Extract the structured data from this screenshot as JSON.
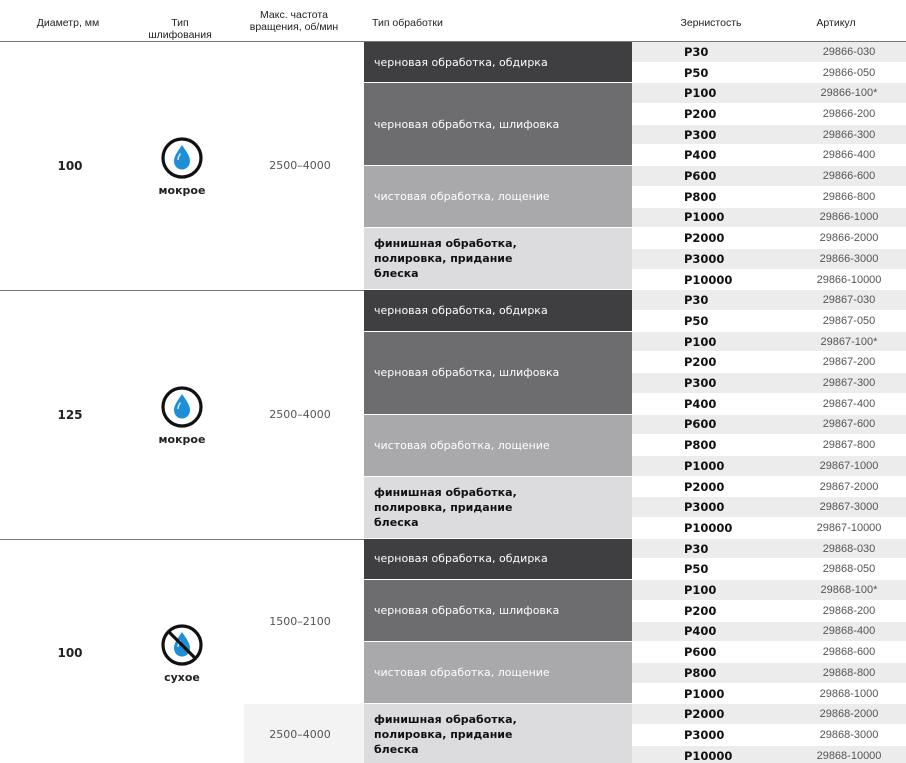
{
  "header": {
    "diameter": "Диаметр, мм",
    "grinding_type": "Тип шлифования",
    "rpm": "Макс. частота вращения, об/мин",
    "processing": "Тип обработки",
    "grit": "Зернистость",
    "article": "Артикул"
  },
  "groups": [
    {
      "diameter": "100",
      "type": "мокрое",
      "icon": "water-drop-icon",
      "rpm": "2500–4000",
      "processing": [
        {
          "label": "черновая обработка, обдирка",
          "rows": 2
        },
        {
          "label": "черновая обработка, шлифовка",
          "rows": 4
        },
        {
          "label": "чистовая обработка, лощение",
          "rows": 3
        },
        {
          "label": "финишная обработка, полировка, придание блеска",
          "rows": 3
        }
      ],
      "rows": [
        {
          "grit": "P30",
          "article": "29866-030"
        },
        {
          "grit": "P50",
          "article": "29866-050"
        },
        {
          "grit": "P100",
          "article": "29866-100*"
        },
        {
          "grit": "P200",
          "article": "29866-200"
        },
        {
          "grit": "P300",
          "article": "29866-300"
        },
        {
          "grit": "P400",
          "article": "29866-400"
        },
        {
          "grit": "P600",
          "article": "29866-600"
        },
        {
          "grit": "P800",
          "article": "29866-800"
        },
        {
          "grit": "P1000",
          "article": "29866-1000"
        },
        {
          "grit": "P2000",
          "article": "29866-2000"
        },
        {
          "grit": "P3000",
          "article": "29866-3000"
        },
        {
          "grit": "P10000",
          "article": "29866-10000"
        }
      ]
    },
    {
      "diameter": "125",
      "type": "мокрое",
      "icon": "water-drop-icon",
      "rpm": "2500–4000",
      "processing": [
        {
          "label": "черновая обработка, обдирка",
          "rows": 2
        },
        {
          "label": "черновая обработка, шлифовка",
          "rows": 4
        },
        {
          "label": "чистовая обработка, лощение",
          "rows": 3
        },
        {
          "label": "финишная обработка, полировка, придание блеска",
          "rows": 3
        }
      ],
      "rows": [
        {
          "grit": "P30",
          "article": "29867-030"
        },
        {
          "grit": "P50",
          "article": "29867-050"
        },
        {
          "grit": "P100",
          "article": "29867-100*"
        },
        {
          "grit": "P200",
          "article": "29867-200"
        },
        {
          "grit": "P300",
          "article": "29867-300"
        },
        {
          "grit": "P400",
          "article": "29867-400"
        },
        {
          "grit": "P600",
          "article": "29867-600"
        },
        {
          "grit": "P800",
          "article": "29867-800"
        },
        {
          "grit": "P1000",
          "article": "29867-1000"
        },
        {
          "grit": "P2000",
          "article": "29867-2000"
        },
        {
          "grit": "P3000",
          "article": "29867-3000"
        },
        {
          "grit": "P10000",
          "article": "29867-10000"
        }
      ]
    },
    {
      "diameter": "100",
      "type": "сухое",
      "icon": "no-water-drop-icon",
      "rpm_primary": "1500–2100",
      "rpm_secondary": "2500–4000",
      "processing": [
        {
          "label": "черновая обработка, обдирка",
          "rows": 2
        },
        {
          "label": "черновая обработка, шлифовка",
          "rows": 3
        },
        {
          "label": "чистовая обработка, лощение",
          "rows": 3
        },
        {
          "label": "финишная обработка, полировка, придание блеска",
          "rows": 3
        }
      ],
      "rows": [
        {
          "grit": "P30",
          "article": "29868-030"
        },
        {
          "grit": "P50",
          "article": "29868-050"
        },
        {
          "grit": "P100",
          "article": "29868-100*"
        },
        {
          "grit": "P200",
          "article": "29868-200"
        },
        {
          "grit": "P400",
          "article": "29868-400"
        },
        {
          "grit": "P600",
          "article": "29868-600"
        },
        {
          "grit": "P800",
          "article": "29868-800"
        },
        {
          "grit": "P1000",
          "article": "29868-1000"
        },
        {
          "grit": "P2000",
          "article": "29868-2000"
        },
        {
          "grit": "P3000",
          "article": "29868-3000"
        },
        {
          "grit": "P10000",
          "article": "29868-10000"
        }
      ]
    }
  ],
  "colors": {
    "proc_dark": "#3f3f42",
    "proc_mid": "#6d6d70",
    "proc_light": "#a9a9ab",
    "proc_pale": "#dcdcde",
    "drop": "#1e8fd6"
  }
}
